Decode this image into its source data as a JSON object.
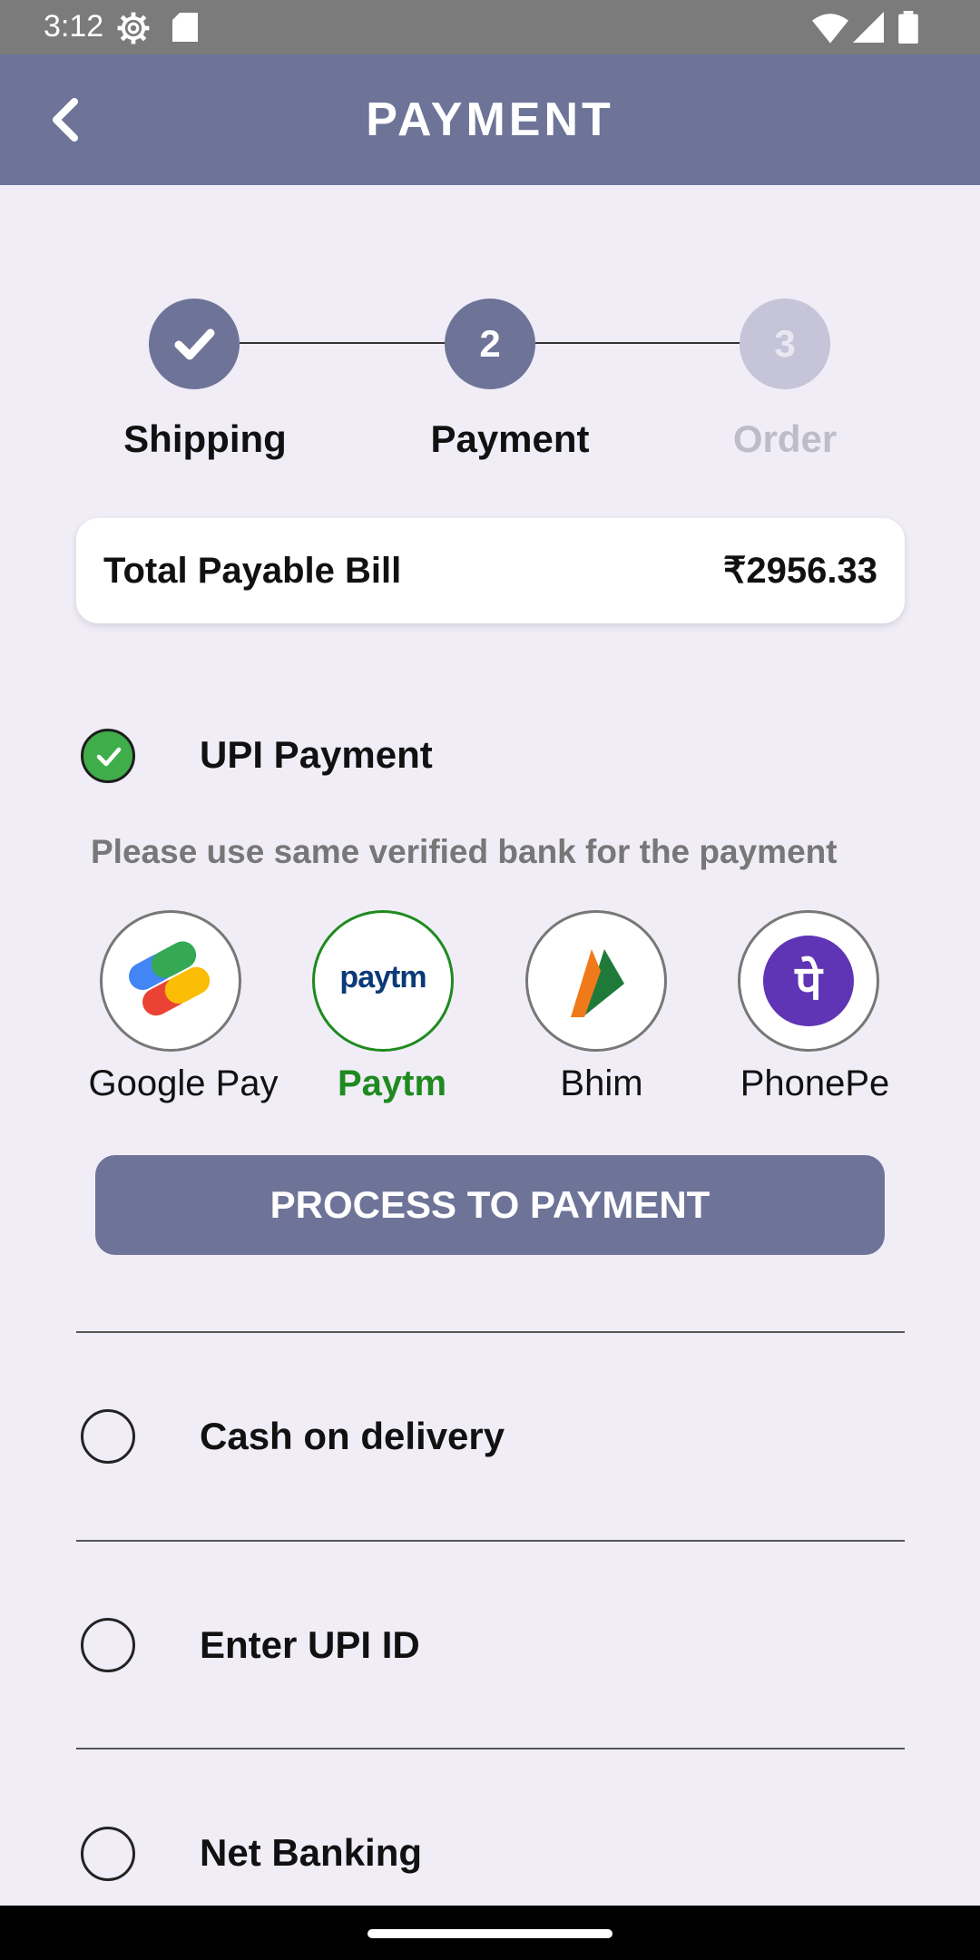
{
  "status_bar": {
    "time": "3:12"
  },
  "app_bar": {
    "title": "PAYMENT"
  },
  "stepper": {
    "steps": [
      {
        "label": "Shipping",
        "number": "",
        "state": "completed"
      },
      {
        "label": "Payment",
        "number": "2",
        "state": "active"
      },
      {
        "label": "Order",
        "number": "3",
        "state": "inactive"
      }
    ]
  },
  "bill": {
    "label": "Total Payable Bill",
    "amount": "₹2956.33"
  },
  "upi_option": {
    "label": "UPI Payment",
    "checked": true,
    "hint": "Please use same verified bank for the payment",
    "apps": [
      {
        "name": "Google Pay",
        "icon": "google-pay-icon",
        "selected": false
      },
      {
        "name": "Paytm",
        "icon": "paytm-icon",
        "selected": true,
        "logo_text": "paytm"
      },
      {
        "name": "Bhim",
        "icon": "bhim-icon",
        "selected": false
      },
      {
        "name": "PhonePe",
        "icon": "phonepe-icon",
        "selected": false,
        "logo_text": "पे"
      }
    ],
    "button_label": "PROCESS TO PAYMENT"
  },
  "other_options": [
    {
      "label": "Cash on delivery",
      "checked": false
    },
    {
      "label": "Enter UPI ID",
      "checked": false
    },
    {
      "label": "Net Banking",
      "checked": false
    }
  ],
  "colors": {
    "primary": "#6E7398",
    "background": "#F0EDF7",
    "selected_green": "#1F8A1F",
    "check_green": "#3FAE4A",
    "inactive_step": "#C5C4D9"
  }
}
